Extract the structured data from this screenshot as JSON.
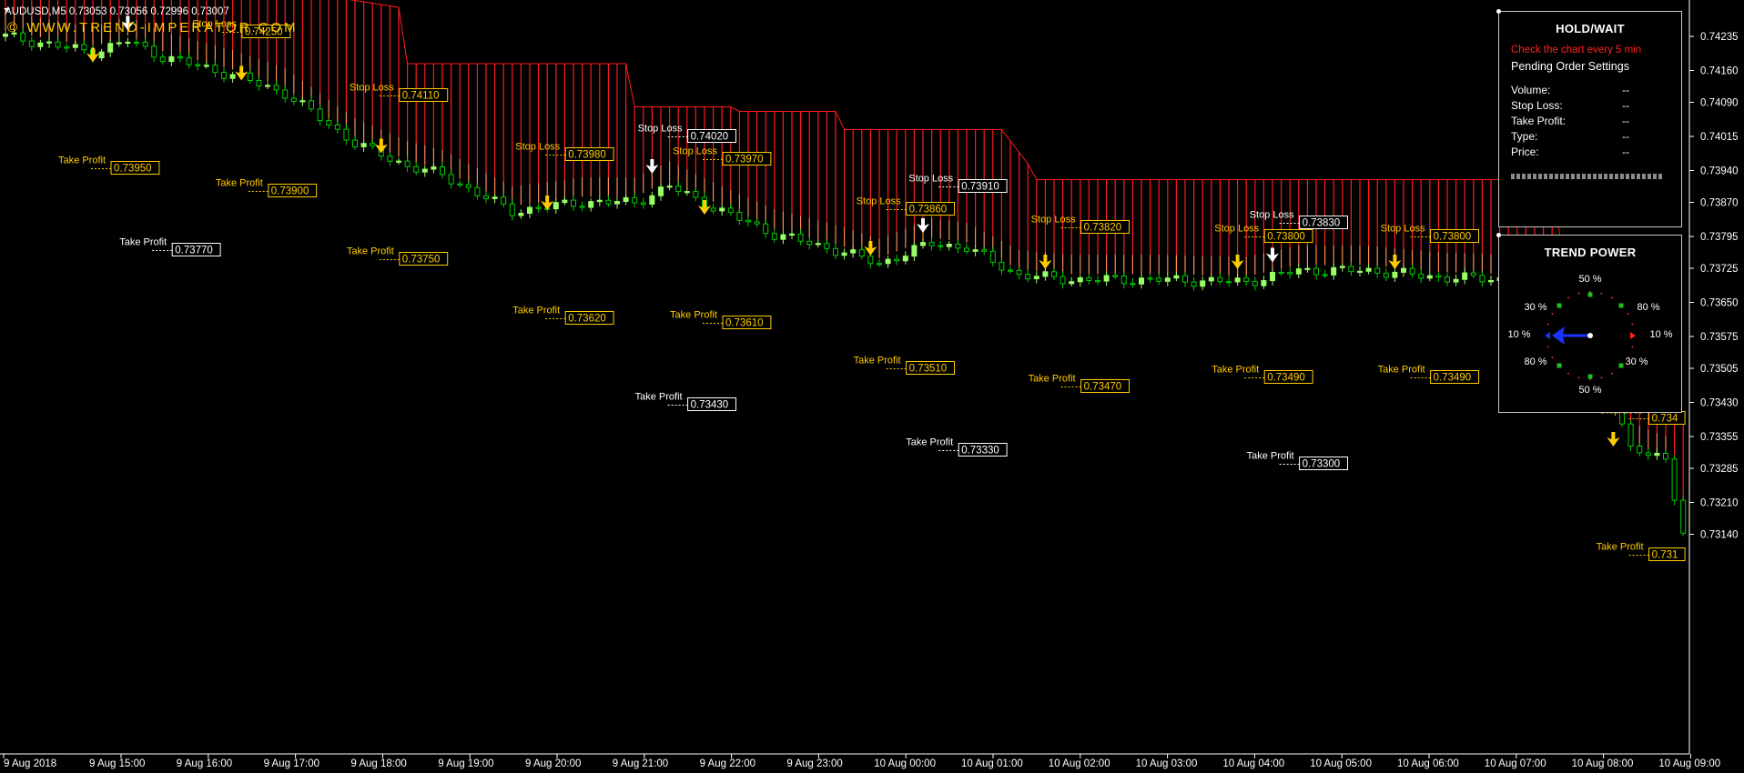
{
  "chart": {
    "header_text": "AUDUSD,M5  0.73053 0.73056 0.72996 0.73007",
    "watermark": "© WWW.TREND-IMPERATOR.COM",
    "colors": {
      "background": "#000000",
      "bull_candle": "#99ff66",
      "bear_candle": "#00cc00",
      "band_red": "#ff1a1a",
      "band_orange": "#ff8c55",
      "axis_text": "#ffffff",
      "signal_yellow": "#ffcc00",
      "signal_white": "#ffffff"
    },
    "price_axis": [
      "0.74235",
      "0.74160",
      "0.74090",
      "0.74015",
      "0.73940",
      "0.73870",
      "0.73795",
      "0.73725",
      "0.73650",
      "0.73575",
      "0.73505",
      "0.73430",
      "0.73355",
      "0.73285",
      "0.73210",
      "0.73140"
    ],
    "time_axis": [
      "9 Aug 2018",
      "9 Aug 15:00",
      "9 Aug 16:00",
      "9 Aug 17:00",
      "9 Aug 18:00",
      "9 Aug 19:00",
      "9 Aug 20:00",
      "9 Aug 21:00",
      "9 Aug 22:00",
      "9 Aug 23:00",
      "10 Aug 00:00",
      "10 Aug 01:00",
      "10 Aug 02:00",
      "10 Aug 03:00",
      "10 Aug 04:00",
      "10 Aug 05:00",
      "10 Aug 06:00",
      "10 Aug 07:00",
      "10 Aug 08:00",
      "10 Aug 09:00"
    ],
    "levels": [
      {
        "type": "Stop Loss",
        "price": "0.74250",
        "color": "yellow",
        "bar": 25
      },
      {
        "type": "Take Profit",
        "price": "0.73950",
        "color": "yellow",
        "bar": 10
      },
      {
        "type": "Take Profit",
        "price": "0.73770",
        "color": "white",
        "bar": 17
      },
      {
        "type": "Stop Loss",
        "price": "0.74110",
        "color": "yellow",
        "bar": 43
      },
      {
        "type": "Take Profit",
        "price": "0.73900",
        "color": "yellow",
        "bar": 28
      },
      {
        "type": "Take Profit",
        "price": "0.73750",
        "color": "yellow",
        "bar": 43
      },
      {
        "type": "Stop Loss",
        "price": "0.73980",
        "color": "yellow",
        "bar": 62
      },
      {
        "type": "Take Profit",
        "price": "0.73620",
        "color": "yellow",
        "bar": 62
      },
      {
        "type": "Stop Loss",
        "price": "0.74020",
        "color": "white",
        "bar": 76
      },
      {
        "type": "Take Profit",
        "price": "0.73430",
        "color": "white",
        "bar": 76
      },
      {
        "type": "Stop Loss",
        "price": "0.73970",
        "color": "yellow",
        "bar": 80
      },
      {
        "type": "Take Profit",
        "price": "0.73610",
        "color": "yellow",
        "bar": 80
      },
      {
        "type": "Stop Loss",
        "price": "0.73860",
        "color": "yellow",
        "bar": 101
      },
      {
        "type": "Take Profit",
        "price": "0.73510",
        "color": "yellow",
        "bar": 101
      },
      {
        "type": "Stop Loss",
        "price": "0.73910",
        "color": "white",
        "bar": 107
      },
      {
        "type": "Take Profit",
        "price": "0.73330",
        "color": "white",
        "bar": 107
      },
      {
        "type": "Stop Loss",
        "price": "0.73820",
        "color": "yellow",
        "bar": 121
      },
      {
        "type": "Take Profit",
        "price": "0.73470",
        "color": "yellow",
        "bar": 121
      },
      {
        "type": "Stop Loss",
        "price": "0.73800",
        "color": "yellow",
        "bar": 142
      },
      {
        "type": "Take Profit",
        "price": "0.73490",
        "color": "yellow",
        "bar": 142
      },
      {
        "type": "Stop Loss",
        "price": "0.73830",
        "color": "white",
        "bar": 146
      },
      {
        "type": "Take Profit",
        "price": "0.73300",
        "color": "white",
        "bar": 146
      },
      {
        "type": "Stop Loss",
        "price": "0.73800",
        "color": "yellow",
        "bar": 161
      },
      {
        "type": "Take Profit",
        "price": "0.73490",
        "color": "yellow",
        "bar": 161
      },
      {
        "type": "Stop Loss",
        "price": "0.734",
        "color": "yellow",
        "bar": 186
      },
      {
        "type": "Take Profit",
        "price": "0.731",
        "color": "yellow",
        "bar": 186
      }
    ],
    "signals": [
      {
        "bar": 14,
        "color": "white",
        "price": 0.7426
      },
      {
        "bar": 10,
        "color": "yellow",
        "price": 0.7419
      },
      {
        "bar": 27,
        "color": "yellow",
        "price": 0.7415
      },
      {
        "bar": 43,
        "color": "yellow",
        "price": 0.7399
      },
      {
        "bar": 62,
        "color": "yellow",
        "price": 0.73865
      },
      {
        "bar": 74,
        "color": "white",
        "price": 0.73945
      },
      {
        "bar": 80,
        "color": "yellow",
        "price": 0.73855
      },
      {
        "bar": 99,
        "color": "yellow",
        "price": 0.73765
      },
      {
        "bar": 105,
        "color": "white",
        "price": 0.73815
      },
      {
        "bar": 119,
        "color": "yellow",
        "price": 0.73735
      },
      {
        "bar": 141,
        "color": "yellow",
        "price": 0.73735
      },
      {
        "bar": 145,
        "color": "white",
        "price": 0.7375
      },
      {
        "bar": 159,
        "color": "yellow",
        "price": 0.73735
      },
      {
        "bar": 184,
        "color": "yellow",
        "price": 0.73345
      }
    ]
  },
  "hold_panel": {
    "title": "HOLD/WAIT",
    "notice": "Check the chart every 5 min",
    "subtitle": "Pending Order Settings",
    "rows": [
      {
        "label": "Volume:",
        "value": "--"
      },
      {
        "label": "Stop Loss:",
        "value": "--"
      },
      {
        "label": "Take Profit:",
        "value": "--"
      },
      {
        "label": "Type:",
        "value": "--"
      },
      {
        "label": "Price:",
        "value": "--"
      }
    ]
  },
  "trend_power": {
    "title": "TREND POWER",
    "labels": [
      {
        "text": "50 %",
        "pos": "top"
      },
      {
        "text": "30 %",
        "pos": "top-left"
      },
      {
        "text": "80 %",
        "pos": "top-right"
      },
      {
        "text": "10 %",
        "pos": "left"
      },
      {
        "text": "10 %",
        "pos": "right"
      },
      {
        "text": "80 %",
        "pos": "bottom-left"
      },
      {
        "text": "30 %",
        "pos": "bottom-right"
      },
      {
        "text": "50 %",
        "pos": "bottom"
      }
    ],
    "arrow_direction": "left",
    "arrow_color": "#1a33ff"
  }
}
